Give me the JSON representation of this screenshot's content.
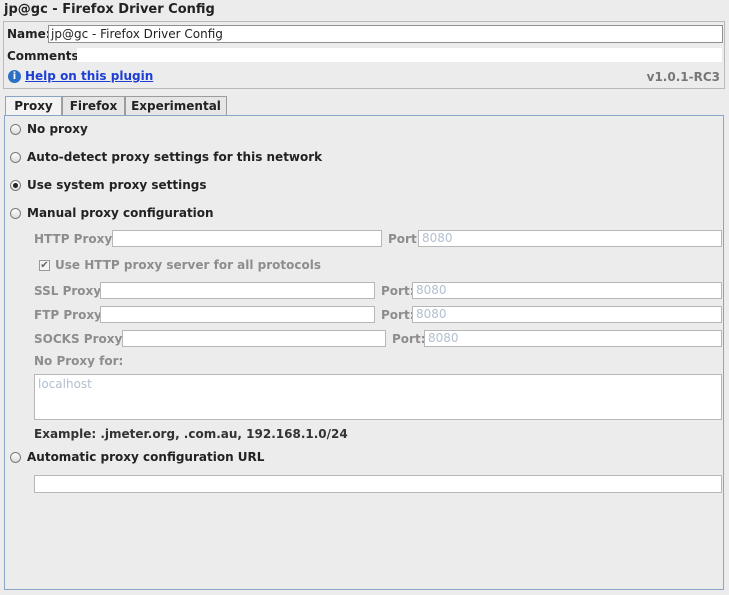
{
  "window": {
    "title": "jp@gc - Firefox Driver Config"
  },
  "header": {
    "name_label": "Name:",
    "name_value": "jp@gc - Firefox Driver Config",
    "comments_label": "Comments:",
    "help_icon_glyph": "i",
    "help_link": "Help on this plugin",
    "version": "v1.0.1-RC3"
  },
  "tabs": [
    {
      "label": "Proxy",
      "active": true
    },
    {
      "label": "Firefox",
      "active": false
    },
    {
      "label": "Experimental",
      "active": false
    }
  ],
  "proxy": {
    "no_proxy": "No proxy",
    "auto_detect": "Auto-detect proxy settings for this network",
    "use_system": "Use system proxy settings",
    "manual": "Manual proxy configuration",
    "selected": "use_system",
    "http_label": "HTTP Proxy:",
    "port_label": "Port:",
    "port_placeholder": "8080",
    "use_http_all": "Use HTTP proxy server for all protocols",
    "use_http_all_checked": true,
    "ssl_label": "SSL Proxy:",
    "ftp_label": "FTP Proxy:",
    "socks_label": "SOCKS Proxy:",
    "no_proxy_for_label": "No Proxy for:",
    "no_proxy_for_placeholder": "localhost",
    "example": "Example: .jmeter.org, .com.au, 192.168.1.0/24",
    "auto_url": "Automatic proxy configuration URL",
    "check_glyph": "✔"
  }
}
